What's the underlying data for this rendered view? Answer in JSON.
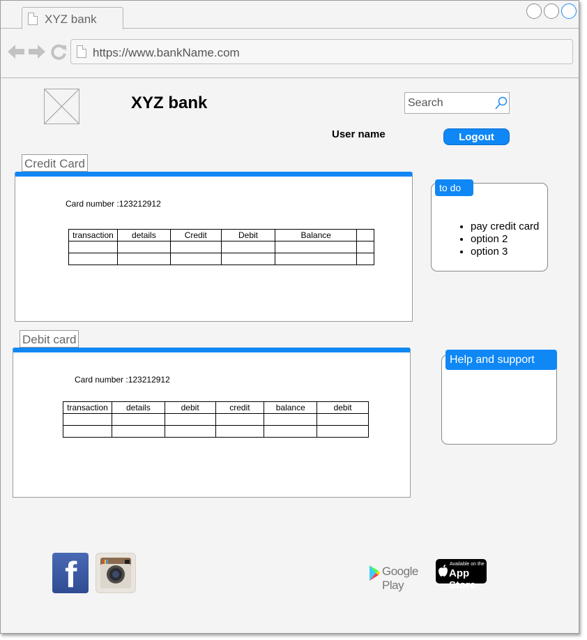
{
  "browser": {
    "tab_title": "XYZ bank",
    "url": "https://www.bankName.com"
  },
  "header": {
    "bank_name": "XYZ bank",
    "search_placeholder": "Search",
    "username": "User name",
    "logout_label": "Logout"
  },
  "credit_card": {
    "label": "Credit Card",
    "card_number": "Card number :123212912",
    "columns": [
      "transaction",
      "details",
      "Credit",
      "Debit",
      "Balance",
      ""
    ]
  },
  "debit_card": {
    "label": "Debit card",
    "card_number": "Card number :123212912",
    "columns": [
      "transaction",
      "details",
      "debit",
      "credit",
      "balance",
      "debit"
    ]
  },
  "todo": {
    "title": "to do",
    "items": [
      "pay credit card",
      "option 2",
      "option 3"
    ]
  },
  "help": {
    "title": "Help and support"
  },
  "footer": {
    "google_play_label": "Google Play",
    "app_store_small": "Available on the",
    "app_store_label": "App Store"
  },
  "colors": {
    "accent": "#0f87f5"
  },
  "icons": [
    "page-icon",
    "back-arrow-icon",
    "forward-arrow-icon",
    "refresh-icon",
    "search-icon",
    "image-placeholder-icon",
    "facebook-icon",
    "instagram-icon",
    "google-play-icon",
    "apple-icon"
  ]
}
